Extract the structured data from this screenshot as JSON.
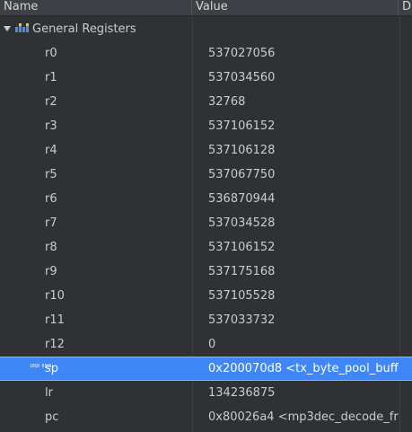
{
  "header": {
    "name": "Name",
    "value": "Value",
    "desc": "D"
  },
  "group": {
    "label": "General Registers"
  },
  "registers": [
    {
      "name": "r0",
      "value": "537027056"
    },
    {
      "name": "r1",
      "value": "537034560"
    },
    {
      "name": "r2",
      "value": "32768"
    },
    {
      "name": "r3",
      "value": "537106152"
    },
    {
      "name": "r4",
      "value": "537106128"
    },
    {
      "name": "r5",
      "value": "537067750"
    },
    {
      "name": "r6",
      "value": "536870944"
    },
    {
      "name": "r7",
      "value": "537034528"
    },
    {
      "name": "r8",
      "value": "537106152"
    },
    {
      "name": "r9",
      "value": "537175168"
    },
    {
      "name": "r10",
      "value": "537105528"
    },
    {
      "name": "r11",
      "value": "537033732"
    },
    {
      "name": "r12",
      "value": "0"
    },
    {
      "name": "sp",
      "value": "0x200070d8 <tx_byte_pool_buff",
      "selected": true,
      "icon": "binary-icon",
      "icon_text": "1010 0101"
    },
    {
      "name": "lr",
      "value": "134236875"
    },
    {
      "name": "pc",
      "value": "0x80026a4 <mp3dec_decode_fr"
    }
  ],
  "colors": {
    "selection": "#3f86f6",
    "background": "#2f3135",
    "header": "#3d4045"
  }
}
